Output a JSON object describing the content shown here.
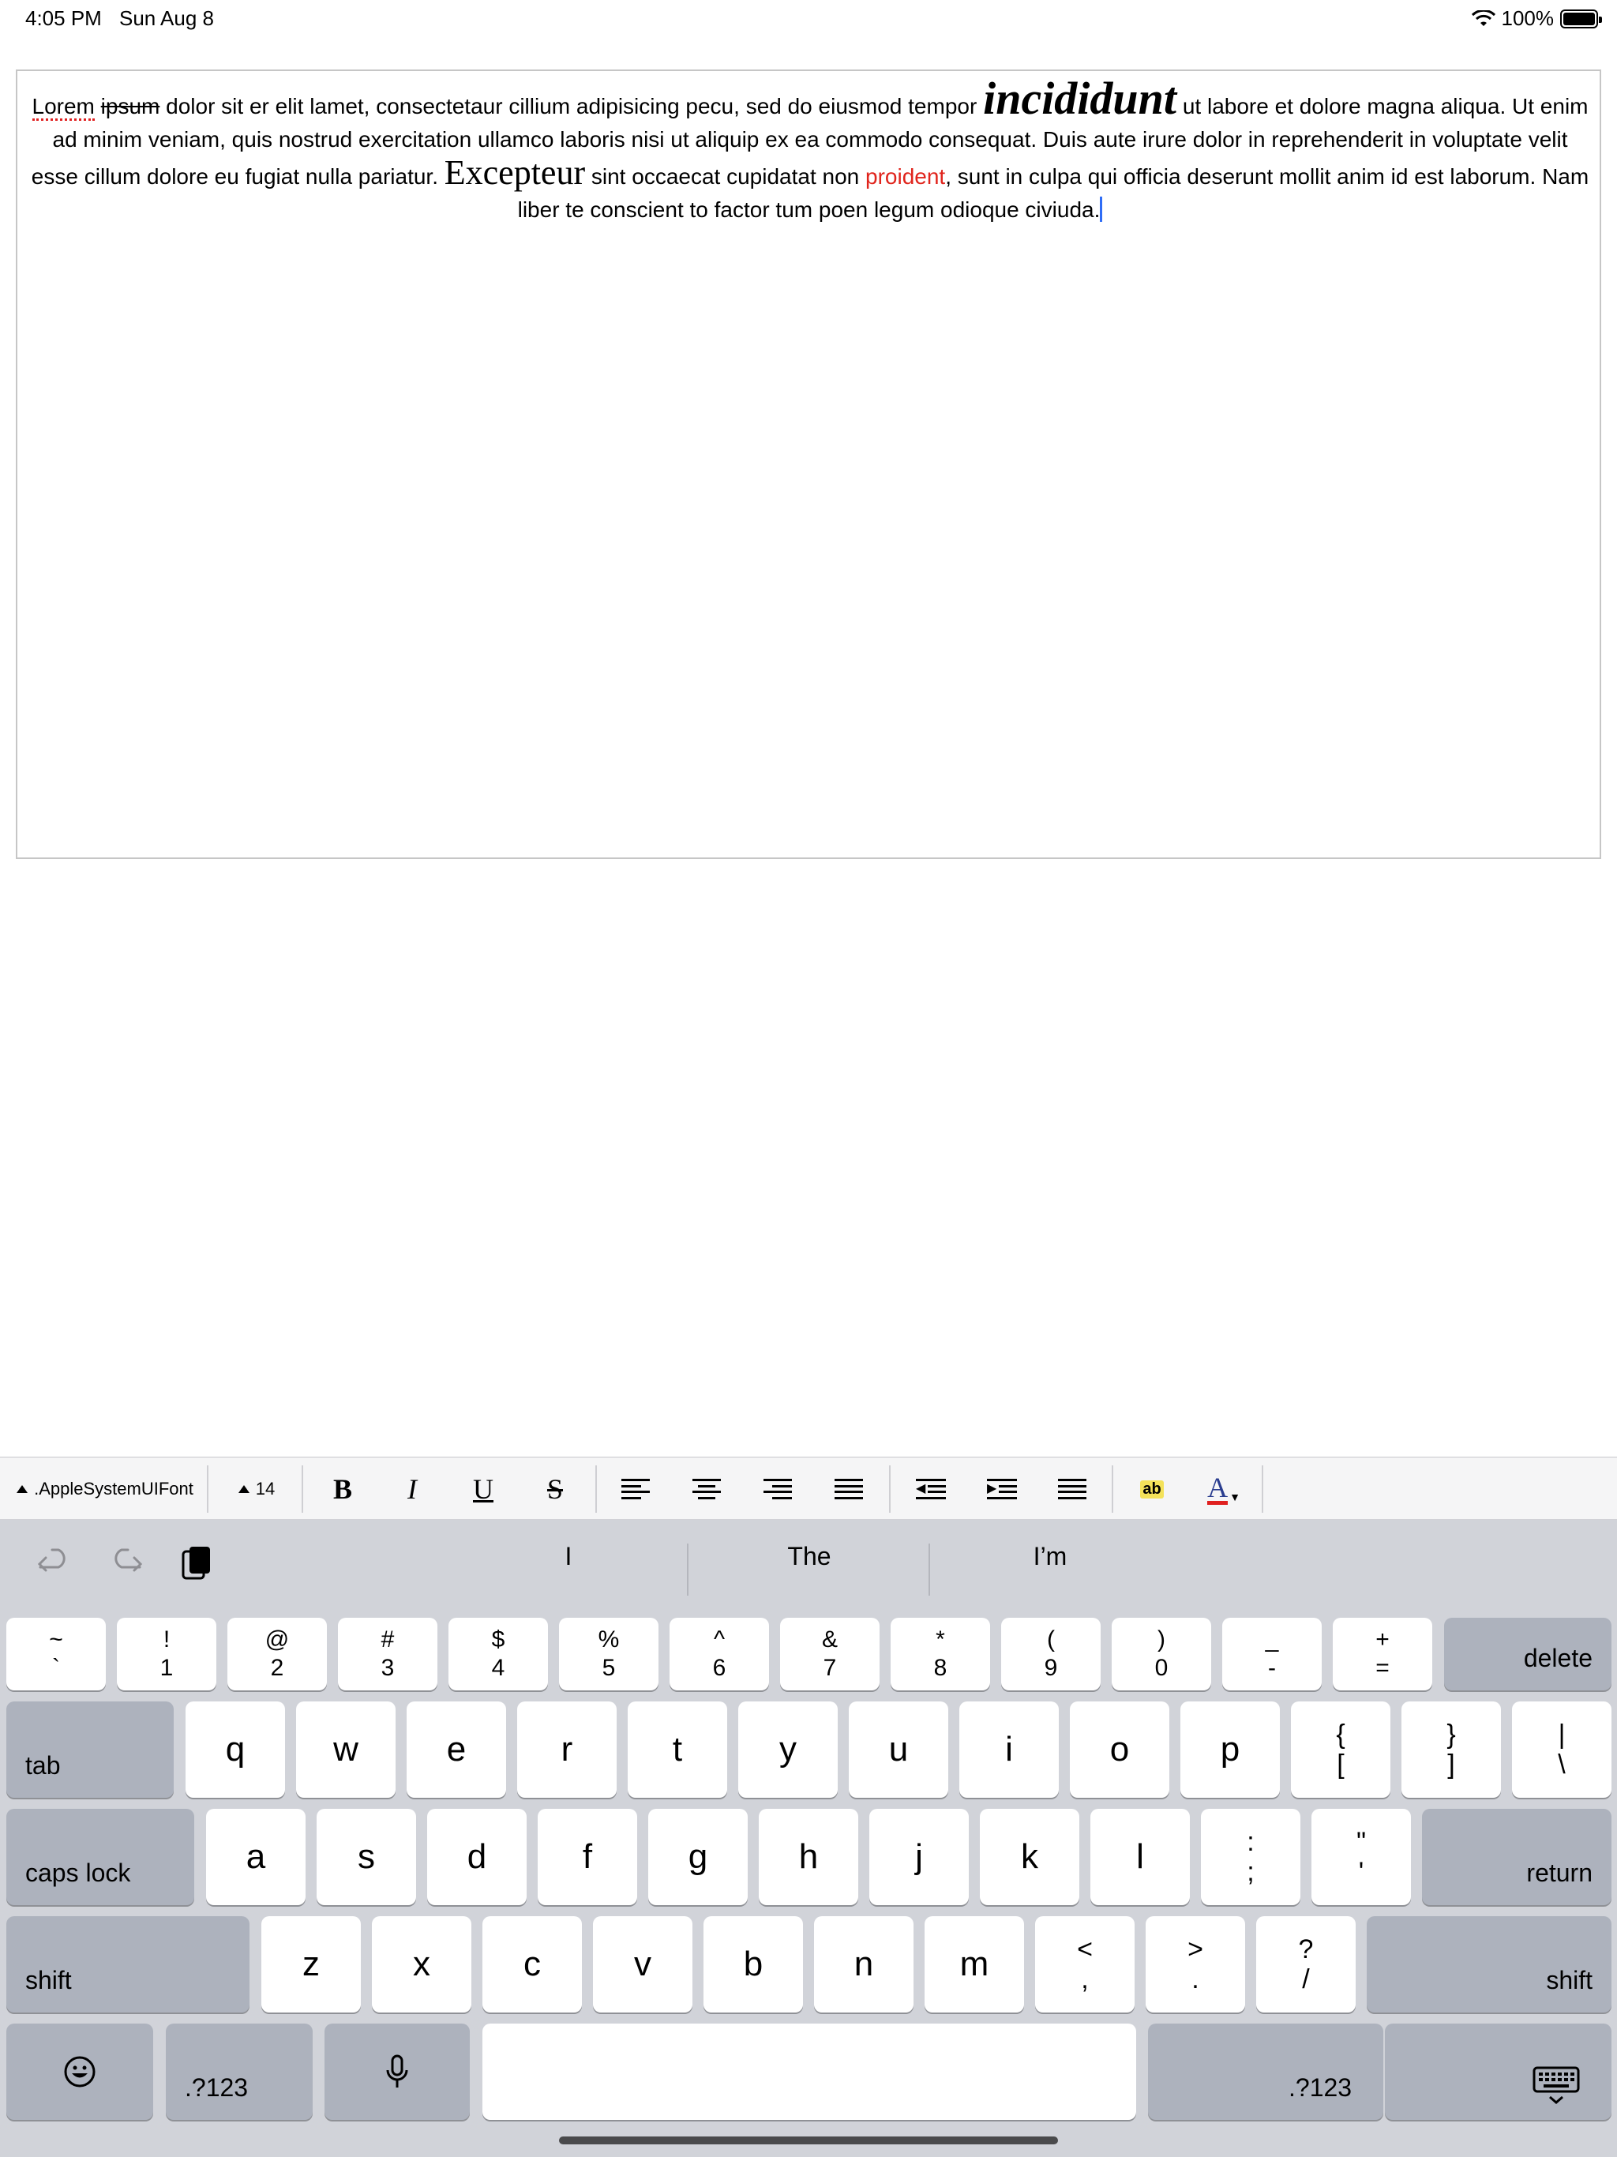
{
  "status_bar": {
    "time": "4:05 PM",
    "date": "Sun Aug 8",
    "battery": "100%"
  },
  "editor": {
    "words": {
      "lorem": "Lorem",
      "ipsum": "ipsum",
      "seg1": "dolor sit er elit lamet, consectetaur cillium adipisicing pecu, sed do eiusmod tempor",
      "incididunt": "incididunt",
      "seg2": "ut labore et dolore magna aliqua. Ut enim ad minim veniam, quis nostrud exercitation ullamco laboris nisi ut aliquip ex ea commodo consequat. Duis aute irure dolor in reprehenderit in voluptate velit esse cillum dolore eu fugiat nulla pariatur.",
      "excepteur": "Excepteur",
      "seg3": "sint occaecat cupidatat non",
      "proident": "proident",
      "seg4": ", sunt in culpa qui officia deserunt mollit anim id est laborum. Nam liber te conscient to factor tum poen legum odioque civiuda."
    }
  },
  "format_toolbar": {
    "font_name": ".AppleSystemUIFont",
    "font_size": "14",
    "bold": "B",
    "italic": "I",
    "underline": "U",
    "strikethrough": "S",
    "text_color_glyph": "A",
    "highlight_glyph": "ab",
    "colors": {
      "accent_red": "#e02020",
      "highlight": "#f4e25a",
      "text_color": "#2a3d8f"
    }
  },
  "shortcut_bar": {
    "suggestions": [
      "I",
      "The",
      "I’m"
    ]
  },
  "keyboard": {
    "number_row": [
      {
        "top": "~",
        "bottom": "`"
      },
      {
        "top": "!",
        "bottom": "1"
      },
      {
        "top": "@",
        "bottom": "2"
      },
      {
        "top": "#",
        "bottom": "3"
      },
      {
        "top": "$",
        "bottom": "4"
      },
      {
        "top": "%",
        "bottom": "5"
      },
      {
        "top": "^",
        "bottom": "6"
      },
      {
        "top": "&",
        "bottom": "7"
      },
      {
        "top": "*",
        "bottom": "8"
      },
      {
        "top": "(",
        "bottom": "9"
      },
      {
        "top": ")",
        "bottom": "0"
      },
      {
        "top": "_",
        "bottom": "-"
      },
      {
        "top": "+",
        "bottom": "="
      }
    ],
    "delete": "delete",
    "tab": "tab",
    "row_q": [
      "q",
      "w",
      "e",
      "r",
      "t",
      "y",
      "u",
      "i",
      "o",
      "p"
    ],
    "row_q_symbols": [
      {
        "top": "{",
        "bottom": "["
      },
      {
        "top": "}",
        "bottom": "]"
      },
      {
        "top": "|",
        "bottom": "\\"
      }
    ],
    "caps_lock": "caps lock",
    "row_a": [
      "a",
      "s",
      "d",
      "f",
      "g",
      "h",
      "j",
      "k",
      "l"
    ],
    "row_a_symbols": [
      {
        "top": ":",
        "bottom": ";"
      },
      {
        "top": "\"",
        "bottom": "'"
      }
    ],
    "return": "return",
    "shift": "shift",
    "row_z": [
      "z",
      "x",
      "c",
      "v",
      "b",
      "n",
      "m"
    ],
    "row_z_symbols": [
      {
        "top": "<",
        "bottom": ","
      },
      {
        "top": ">",
        "bottom": "."
      },
      {
        "top": "?",
        "bottom": "/"
      }
    ],
    "numbers_key": ".?123"
  }
}
